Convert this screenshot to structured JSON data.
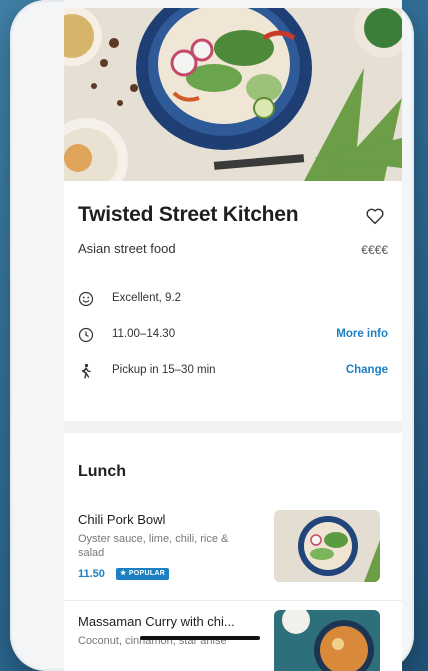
{
  "restaurant": {
    "name": "Twisted Street Kitchen",
    "cuisine": "Asian street food",
    "price_level": "€€€€",
    "rating_text": "Excellent, 9.2",
    "hours": "11.00–14.30",
    "hours_link": "More info",
    "pickup": "Pickup in 15–30 min",
    "pickup_link": "Change"
  },
  "menu": {
    "section_title": "Lunch",
    "items": [
      {
        "name": "Chili Pork Bowl",
        "description": "Oyster sauce, lime, chili, rice & salad",
        "price": "11.50",
        "badge": "★ POPULAR"
      },
      {
        "name": "Massaman Curry with chi...",
        "description": "Coconut, cinnamon, star anise"
      }
    ]
  },
  "icons": {
    "favorite": "heart-outline-icon",
    "rating": "smiley-icon",
    "hours": "clock-icon",
    "pickup": "walking-person-icon"
  },
  "colors": {
    "accent": "#1b7fc4",
    "background": "#2e6a92"
  }
}
